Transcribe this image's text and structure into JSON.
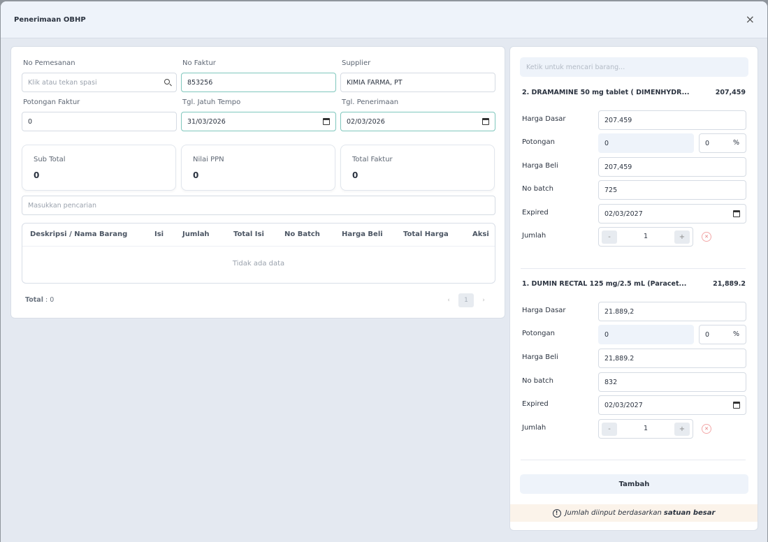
{
  "modal": {
    "title": "Penerimaan OBHP",
    "close_label": "×"
  },
  "form": {
    "no_pemesanan": {
      "label": "No Pemesanan",
      "placeholder": "Klik atau tekan spasi"
    },
    "no_faktur": {
      "label": "No Faktur",
      "value": "853256"
    },
    "supplier": {
      "label": "Supplier",
      "value": "KIMIA FARMA, PT"
    },
    "potongan_faktur": {
      "label": "Potongan Faktur",
      "value": "0"
    },
    "tgl_jatuh_tempo": {
      "label": "Tgl. Jatuh Tempo",
      "value": "31/03/2026"
    },
    "tgl_penerimaan": {
      "label": "Tgl. Penerimaan",
      "value": "02/03/2026"
    }
  },
  "stats": [
    {
      "label": "Sub Total",
      "value": "0"
    },
    {
      "label": "Nilai PPN",
      "value": "0"
    },
    {
      "label": "Total Faktur",
      "value": "0"
    }
  ],
  "search": {
    "placeholder": "Masukkan pencarian"
  },
  "table": {
    "headers": [
      "Deskripsi / Nama Barang",
      "Isi",
      "Jumlah",
      "Total Isi",
      "No Batch",
      "Harga Beli",
      "Total Harga",
      "Aksi"
    ],
    "empty_text": "Tidak ada data"
  },
  "footer": {
    "total_label": "Total",
    "total_value": ": 0",
    "prev": "‹",
    "page": "1",
    "next": "›"
  },
  "right": {
    "search_placeholder": "Ketik untuk mencari barang...",
    "labels": {
      "harga_dasar": "Harga Dasar",
      "potongan": "Potongan",
      "harga_beli": "Harga Beli",
      "no_batch": "No batch",
      "expired": "Expired",
      "jumlah": "Jumlah"
    },
    "items": [
      {
        "title": "2.  DRAMAMINE 50 mg tablet ( DIMENHYDR...",
        "price": "207,459",
        "harga_dasar": "207.459",
        "potongan": "0",
        "potongan_pct": "0",
        "harga_beli": "207,459",
        "no_batch": "725",
        "expired": "02/03/2027",
        "jumlah": "1"
      },
      {
        "title": "1.  DUMIN RECTAL 125 mg/2.5 mL (Paracet...",
        "price": "21,889.2",
        "harga_dasar": "21.889,2",
        "potongan": "0",
        "potongan_pct": "0",
        "harga_beli": "21,889.2",
        "no_batch": "832",
        "expired": "02/03/2027",
        "jumlah": "1"
      }
    ],
    "percent_sign": "%",
    "minus": "-",
    "plus": "+",
    "tambah_label": "Tambah",
    "note_text": "Jumlah diinput berdasarkan",
    "note_bold": "satuan besar",
    "info_glyph": "!"
  }
}
